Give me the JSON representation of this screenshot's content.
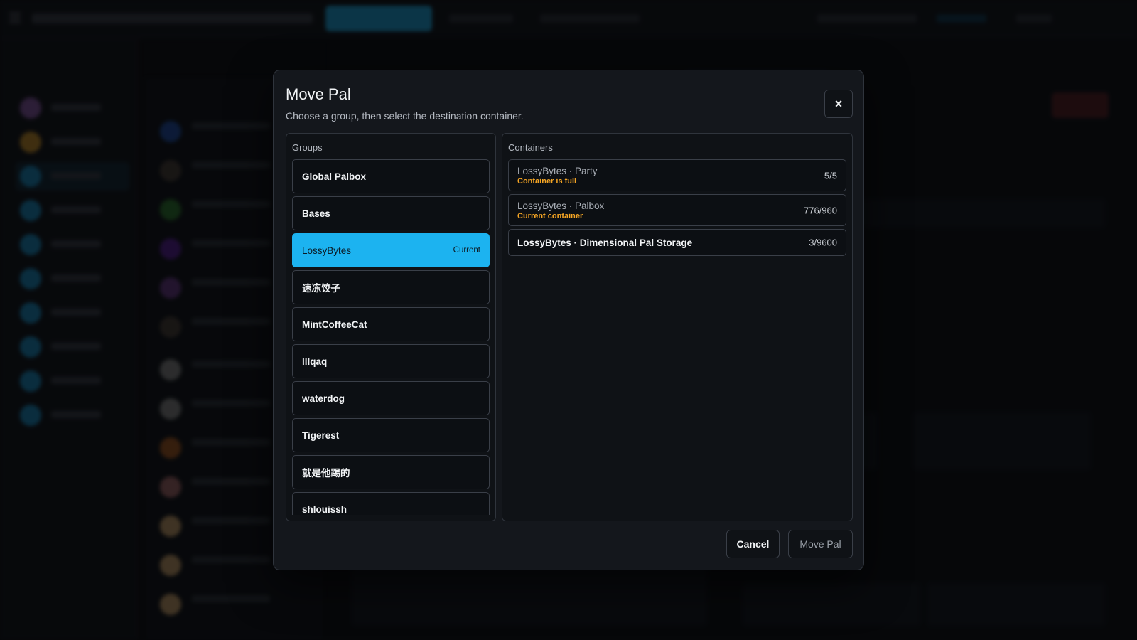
{
  "modal": {
    "title": "Move Pal",
    "subtitle": "Choose a group, then select the destination container.",
    "close_label": "×",
    "groups_label": "Groups",
    "containers_label": "Containers",
    "cancel_label": "Cancel",
    "confirm_label": "Move Pal"
  },
  "groups": [
    {
      "name": "Global Palbox",
      "tag": ""
    },
    {
      "name": "Bases",
      "tag": ""
    },
    {
      "name": "LossyBytes",
      "tag": "Current"
    },
    {
      "name": "速冻饺子",
      "tag": ""
    },
    {
      "name": "MintCoffeeCat",
      "tag": ""
    },
    {
      "name": "lllqaq",
      "tag": ""
    },
    {
      "name": "waterdog",
      "tag": ""
    },
    {
      "name": "Tigerest",
      "tag": ""
    },
    {
      "name": "就是他踢的",
      "tag": ""
    },
    {
      "name": "shlouissh",
      "tag": ""
    }
  ],
  "containers": [
    {
      "name": "LossyBytes · Party",
      "status": "Container is full",
      "count": "5/5"
    },
    {
      "name": "LossyBytes · Palbox",
      "status": "Current container",
      "count": "776/960"
    },
    {
      "name": "LossyBytes · Dimensional Pal Storage",
      "status": "",
      "count": "3/9600"
    }
  ],
  "colors": {
    "accent": "#1cb3f0",
    "warning": "#f5a524",
    "modal_bg": "#14171c"
  }
}
